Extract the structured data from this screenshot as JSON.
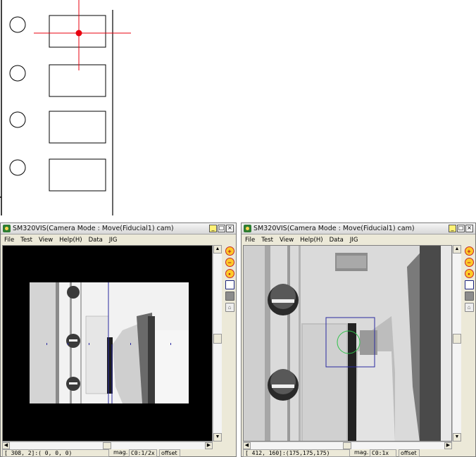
{
  "windows": {
    "left": {
      "title": "SM320VIS(Camera Mode : Move(Fiducial1) cam)",
      "menu": [
        "File",
        "Test",
        "View",
        "Help(H)",
        "Data",
        "JIG"
      ],
      "status": {
        "coords": "[ 308,  2]:( 0, 0, 0)",
        "mag_label": "mag.",
        "mag_value": "C0:1/2x",
        "offset": "offset"
      }
    },
    "right": {
      "title": "SM320VIS(Camera Mode : Move(Fiducial1) cam)",
      "menu": [
        "File",
        "Test",
        "View",
        "Help(H)",
        "Data",
        "JIG"
      ],
      "status": {
        "coords": "[ 412, 160]:(175,175,175)",
        "mag_label": "mag.",
        "mag_value": "C0:1x",
        "offset": "offset"
      }
    },
    "title_buttons": [
      "_",
      "□",
      "×"
    ],
    "toolbar_icons": [
      "zoom-in-icon",
      "zoom-out-icon",
      "zoom-fit-icon",
      "window-icon",
      "gray-square-icon",
      "lock-icon"
    ],
    "scroll_arrows": {
      "up": "▲",
      "down": "▼",
      "left": "◀",
      "right": "▶"
    }
  },
  "colors": {
    "crosshair": "#e8000f",
    "roi_box": "#2a2aa0",
    "fiducial_circle": "#2fc24a"
  }
}
